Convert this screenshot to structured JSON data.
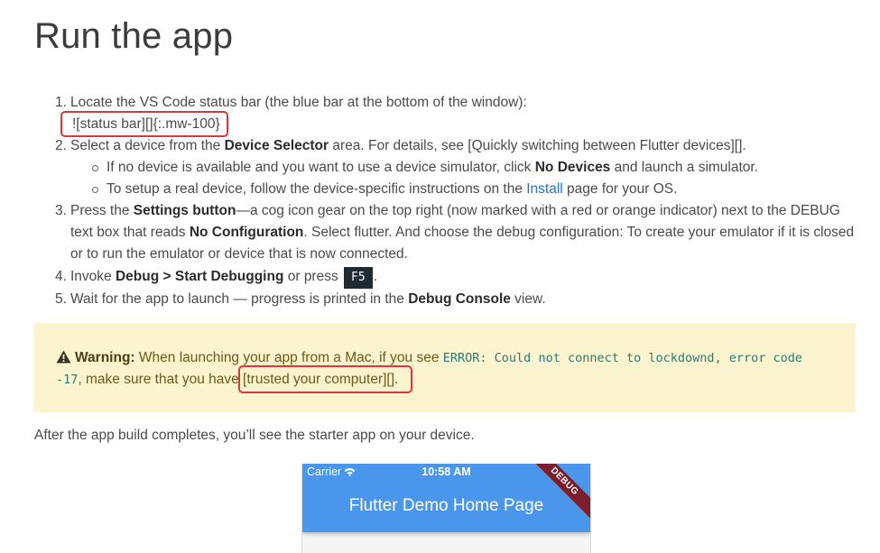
{
  "title": "Run the app",
  "steps": [
    {
      "num": "1.",
      "text": "Locate the VS Code status bar (the blue bar at the bottom of the window):",
      "line2": "![status bar][]{:.mw-100}"
    },
    {
      "num": "2.",
      "pre": "Select a device from the ",
      "bold": "Device Selector",
      "post": " area. For details, see [Quickly switching between Flutter devices][].",
      "subs": [
        {
          "pre": "If no device is available and you want to use a device simulator, click ",
          "bold": "No Devices",
          "post": " and launch a simulator."
        },
        {
          "pre": "To setup a real device, follow the device-specific instructions on the ",
          "link": "Install",
          "post": " page for your OS."
        }
      ]
    },
    {
      "num": "3.",
      "pre": "Press the ",
      "bold1": "Settings button",
      "mid": "—a cog icon gear on the top right (now marked with a red or orange indicator) next to the DEBUG text box that reads ",
      "bold2": "No Configuration",
      "post": ". Select flutter. And choose the debug configuration: To create your emulator if it is closed or to run the emulator or device that is now connected."
    },
    {
      "num": "4.",
      "pre": "Invoke ",
      "bold": "Debug > Start Debugging",
      "mid": " or press ",
      "key": "F5",
      "post": "."
    },
    {
      "num": "5.",
      "pre": "Wait for the app to launch — progress is printed in the ",
      "bold": "Debug Console",
      "post": " view."
    }
  ],
  "warning": {
    "icon": "warning-triangle-icon",
    "title": "Warning:",
    "pre": " When launching your app from a Mac, if you see ",
    "code1": "ERROR: Could not connect to lockdownd, error code",
    "code2": "-17",
    "mid": ", make sure that you have ",
    "boxed": "[trusted your computer][]",
    "post": "."
  },
  "after_text": "After the app build completes, you’ll see the starter app on your device.",
  "phone": {
    "carrier": "Carrier",
    "time": "10:58 AM",
    "app_title": "Flutter Demo Home Page",
    "debug_ribbon": "DEBUG",
    "appbar_color": "#4a96ec"
  },
  "colors": {
    "highlight_box": "#e0353b",
    "warning_bg": "#fcf3cf",
    "link": "#1a73e8"
  }
}
